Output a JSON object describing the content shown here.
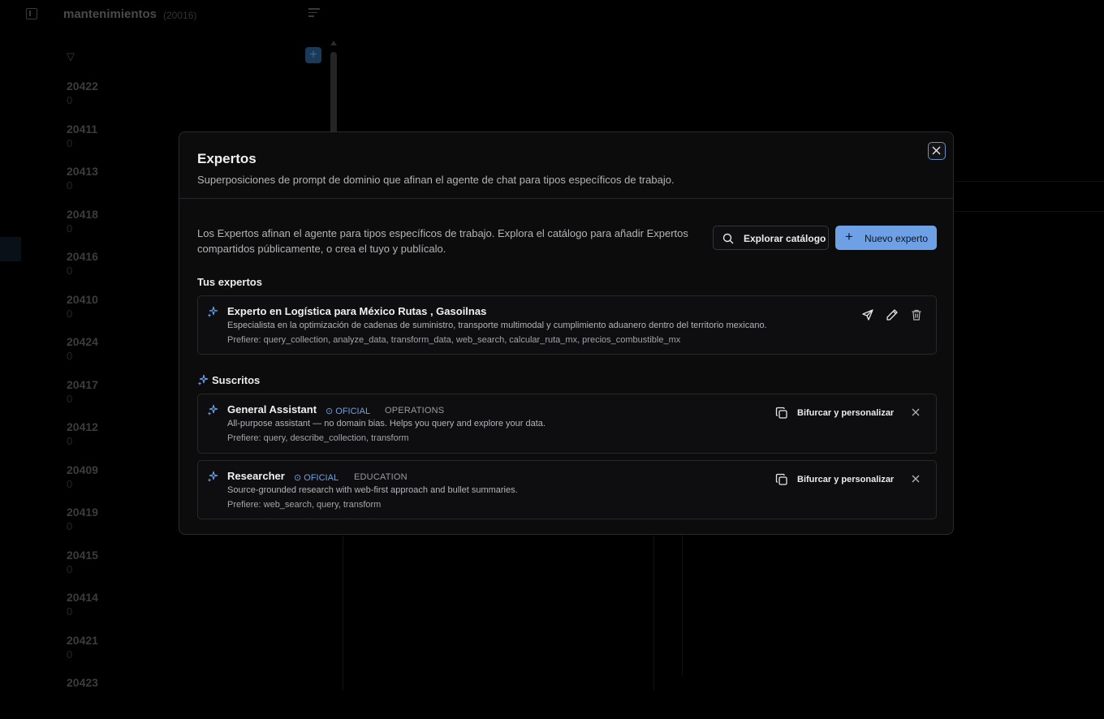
{
  "background": {
    "collection_title": "mantenimientos",
    "collection_count": "(20016)",
    "records": [
      {
        "id": "20422",
        "sub": "0"
      },
      {
        "id": "20411",
        "sub": "0"
      },
      {
        "id": "20413",
        "sub": "0"
      },
      {
        "id": "20418",
        "sub": "0"
      },
      {
        "id": "20416",
        "sub": "0"
      },
      {
        "id": "20410",
        "sub": "0"
      },
      {
        "id": "20424",
        "sub": "0"
      },
      {
        "id": "20417",
        "sub": "0"
      },
      {
        "id": "20412",
        "sub": "0"
      },
      {
        "id": "20409",
        "sub": "0"
      },
      {
        "id": "20419",
        "sub": "0"
      },
      {
        "id": "20415",
        "sub": "0"
      },
      {
        "id": "20414",
        "sub": "0"
      },
      {
        "id": "20421",
        "sub": "0"
      },
      {
        "id": "20423",
        "sub": ""
      }
    ]
  },
  "modal": {
    "title": "Expertos",
    "subtitle": "Superposiciones de prompt de dominio que afinan el agente de chat para tipos específicos de trabajo.",
    "intro": "Los Expertos afinan el agente para tipos específicos de trabajo. Explora el catálogo para añadir Expertos compartidos públicamente, o crea el tuyo y publícalo.",
    "explore_label": "Explorar catálogo",
    "new_label": "Nuevo experto",
    "yours_title": "Tus expertos",
    "subscribed_title": "Suscritos",
    "your_experts": [
      {
        "name": "Experto en Logística para México Rutas , Gasoilnas",
        "description": "Especialista en la optimización de cadenas de suministro, transporte multimodal y cumplimiento aduanero dentro del territorio mexicano.",
        "prefers": "Prefiere: query_collection, analyze_data, transform_data, web_search, calcular_ruta_mx, precios_combustible_mx"
      }
    ],
    "subscribed": [
      {
        "name": "General Assistant",
        "badge": "OFICIAL",
        "category": "OPERATIONS",
        "description": "All-purpose assistant — no domain bias. Helps you query and explore your data.",
        "prefers": "Prefiere: query, describe_collection, transform",
        "fork_label": "Bifurcar y personalizar"
      },
      {
        "name": "Researcher",
        "badge": "OFICIAL",
        "category": "EDUCATION",
        "description": "Source-grounded research with web-first approach and bullet summaries.",
        "prefers": "Prefiere: web_search, query, transform",
        "fork_label": "Bifurcar y personalizar"
      }
    ]
  },
  "colors": {
    "accent": "#6ea0e6",
    "background": "#000000",
    "modal_bg": "#0c0c0d"
  }
}
